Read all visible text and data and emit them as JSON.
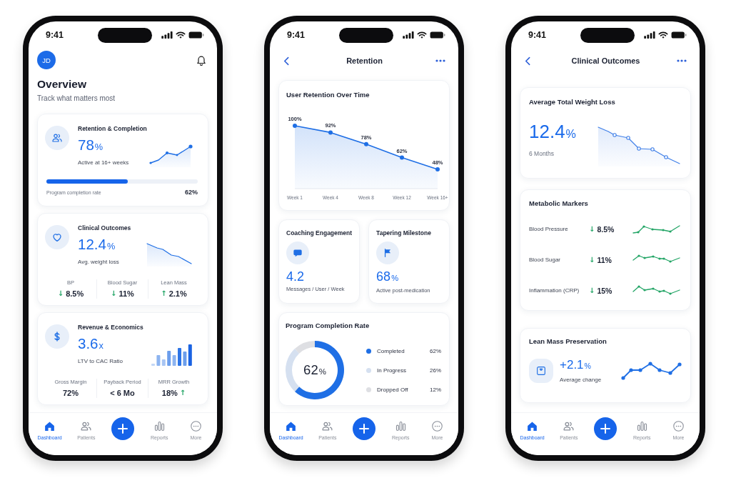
{
  "phones": [
    {
      "kind": "overview",
      "status_time": "9:41",
      "avatar": "JD",
      "title": "Overview",
      "subtitle": "Track what matters most",
      "cards": [
        {
          "title": "Retention & Completion",
          "value": "78",
          "unit": "%",
          "caption": "Active at 16+ weeks",
          "progress": {
            "level": 0.54,
            "label": "Program completion rate",
            "reading": "62%"
          }
        },
        {
          "title": "Clinical Outcomes",
          "value": "12.4",
          "unit": "%",
          "caption": "Avg. weight loss",
          "stats": [
            {
              "label": "BP",
              "value": "8.5%",
              "trend": "↓"
            },
            {
              "label": "Blood Sugar",
              "value": "11%",
              "trend": "↓"
            },
            {
              "label": "Lean Mass",
              "value": "2.1%",
              "trend": "↑"
            }
          ]
        },
        {
          "title": "Revenue & Economics",
          "value": "3.6",
          "unit": "x",
          "caption": "LTV to CAC Ratio",
          "stats": [
            {
              "label": "Gross Margin",
              "value": "72%"
            },
            {
              "label": "Payback Period",
              "value": "< 6 Mo"
            },
            {
              "label": "MRR Growth",
              "value": "18%",
              "trend": "↑"
            }
          ]
        }
      ],
      "tab_bar": [
        {
          "label": "Dashboard",
          "selected": true
        },
        {
          "label": "Patients",
          "selected": false
        },
        {
          "label": "Reports",
          "selected": false
        },
        {
          "label": "More",
          "selected": false
        }
      ]
    },
    {
      "kind": "retention",
      "status_time": "9:41",
      "nav_title": "Retention",
      "chart_card": {
        "title": "User Retention Over Time",
        "chart_data": {
          "type": "area",
          "categories": [
            "Week 1",
            "Week 4",
            "Week 8",
            "Week 12",
            "Week 16+"
          ],
          "series": [
            {
              "color": "#1f6fe5",
              "values": [
                100,
                92,
                78,
                62,
                48
              ],
              "value_labels": [
                "100%",
                "92%",
                "78%",
                "62%",
                "48%"
              ]
            }
          ],
          "data_labels": true
        }
      },
      "metric_cards": [
        {
          "title": "Coaching Engagement",
          "value": "4.2",
          "caption": "Messages / User / Week"
        },
        {
          "title": "Tapering Milestone",
          "value": "68",
          "unit": "%",
          "caption": "Active post-medication"
        }
      ],
      "completion_card": {
        "title": "Program Completion Rate",
        "center_value": "62",
        "center_unit": "%",
        "chart_data": {
          "type": "donut",
          "values": [
            62,
            26,
            12
          ]
        },
        "legend": [
          {
            "label": "Completed",
            "value": "62%",
            "color": "#1f6fe5"
          },
          {
            "label": "In Progress",
            "value": "26%",
            "color": "#d5e0f0"
          },
          {
            "label": "Dropped Off",
            "value": "12%",
            "color": "#dedfe3"
          }
        ]
      },
      "tab_bar": [
        {
          "label": "Dashboard",
          "selected": true
        },
        {
          "label": "Patients",
          "selected": false
        },
        {
          "label": "Reports",
          "selected": false
        },
        {
          "label": "More",
          "selected": false
        }
      ]
    },
    {
      "kind": "clinical",
      "status_time": "9:41",
      "nav_title": "Clinical Outcomes",
      "weight_card": {
        "title": "Average Total Weight Loss",
        "value": "12.4",
        "unit": "%",
        "caption": "6 Months"
      },
      "markers_card": {
        "title": "Metabolic Markers",
        "rows": [
          {
            "label": "Blood Pressure",
            "value": "8.5%",
            "trend": "↓"
          },
          {
            "label": "Blood Sugar",
            "value": "11%",
            "trend": "↓"
          },
          {
            "label": "Inflammation (CRP)",
            "value": "15%",
            "trend": "↓"
          }
        ]
      },
      "lean_card": {
        "title": "Lean Mass Preservation",
        "value": "+2.1",
        "unit": "%",
        "caption": "Average change"
      },
      "tab_bar": [
        {
          "label": "Dashboard",
          "selected": true
        },
        {
          "label": "Patients",
          "selected": false
        },
        {
          "label": "Reports",
          "selected": false
        },
        {
          "label": "More",
          "selected": false
        }
      ]
    }
  ]
}
